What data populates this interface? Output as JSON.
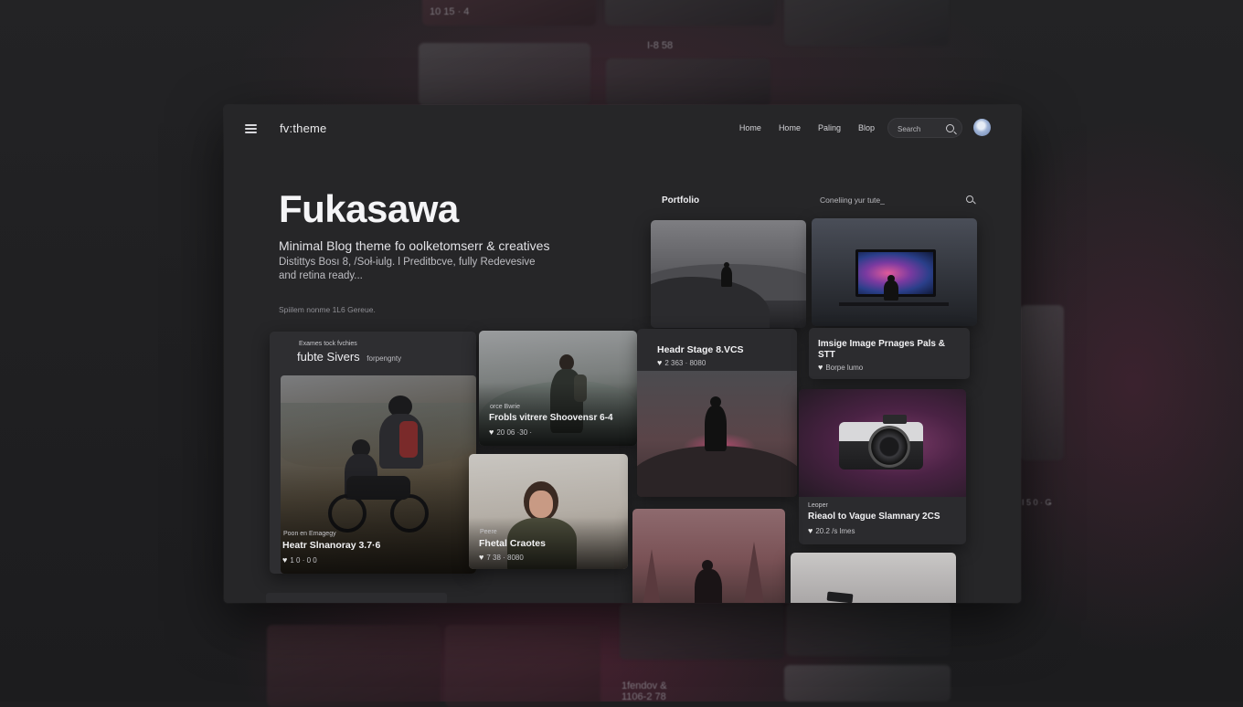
{
  "background": {
    "ghost_texts": [
      "10 15 · 4",
      "I-8 58",
      "I 5 0 · Ǥ",
      "1fendov &",
      "1106-2 78"
    ]
  },
  "header": {
    "logo": "fv:theme",
    "nav": [
      "Home",
      "Home",
      "Paling",
      "Blop"
    ],
    "search_placeholder": "Search"
  },
  "hero": {
    "title": "Fukasawa",
    "subtitle": "Minimal Blog theme fo oolketomserr & creatives",
    "description": "Distittys Bosı 8, /Soł-iulg. l Preditbcve, fully Redevesive and retina ready...",
    "meta": "Spiilem nonme 1L6 Gereue."
  },
  "portfolio": {
    "label": "Portfolio",
    "filter_label": "Coneliing yur tute_"
  },
  "cards": {
    "featured": {
      "eyebrow": "Exames tock fvchies",
      "heading": "fubte Sivers",
      "heading_tag": "forpengnty",
      "small": "Poon en Emagegy",
      "title": "Heatr Slnanoray 3.7·6",
      "meta": "1 0 · 0 0"
    },
    "hiker": {
      "small": "orce Bwrie",
      "title": "Frobls vitrere Shoovensr 6-4",
      "meta": "20 06 ·30 ·"
    },
    "portrait": {
      "small": "Peere",
      "title": "Fhetal Craotes",
      "meta": "7 38 · 8080"
    },
    "mountain": {
      "title": "Headr Stage 8.VCS",
      "meta": "2 363 · 8080"
    },
    "monitor": {
      "title": "Imsige Image Prnages Pals & STT",
      "meta": "Borpe lumo"
    },
    "camera": {
      "small": "Leoper",
      "title": "Rieaol to Vague Slamnary 2CS",
      "meta": "20.2 /s lmes"
    }
  }
}
